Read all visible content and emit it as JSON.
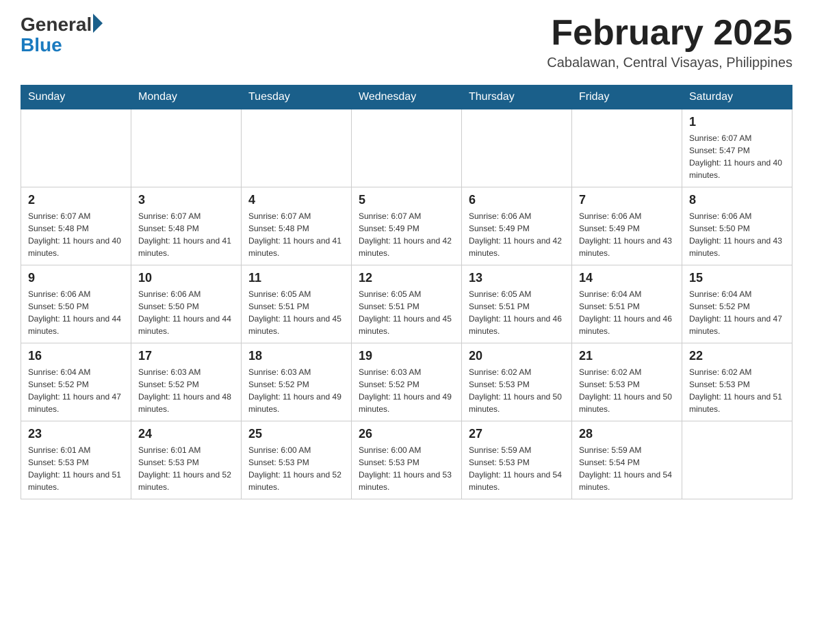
{
  "header": {
    "logo_general": "General",
    "logo_blue": "Blue",
    "month_title": "February 2025",
    "location": "Cabalawan, Central Visayas, Philippines"
  },
  "days_of_week": [
    "Sunday",
    "Monday",
    "Tuesday",
    "Wednesday",
    "Thursday",
    "Friday",
    "Saturday"
  ],
  "weeks": [
    [
      {
        "day": "",
        "sunrise": "",
        "sunset": "",
        "daylight": ""
      },
      {
        "day": "",
        "sunrise": "",
        "sunset": "",
        "daylight": ""
      },
      {
        "day": "",
        "sunrise": "",
        "sunset": "",
        "daylight": ""
      },
      {
        "day": "",
        "sunrise": "",
        "sunset": "",
        "daylight": ""
      },
      {
        "day": "",
        "sunrise": "",
        "sunset": "",
        "daylight": ""
      },
      {
        "day": "",
        "sunrise": "",
        "sunset": "",
        "daylight": ""
      },
      {
        "day": "1",
        "sunrise": "Sunrise: 6:07 AM",
        "sunset": "Sunset: 5:47 PM",
        "daylight": "Daylight: 11 hours and 40 minutes."
      }
    ],
    [
      {
        "day": "2",
        "sunrise": "Sunrise: 6:07 AM",
        "sunset": "Sunset: 5:48 PM",
        "daylight": "Daylight: 11 hours and 40 minutes."
      },
      {
        "day": "3",
        "sunrise": "Sunrise: 6:07 AM",
        "sunset": "Sunset: 5:48 PM",
        "daylight": "Daylight: 11 hours and 41 minutes."
      },
      {
        "day": "4",
        "sunrise": "Sunrise: 6:07 AM",
        "sunset": "Sunset: 5:48 PM",
        "daylight": "Daylight: 11 hours and 41 minutes."
      },
      {
        "day": "5",
        "sunrise": "Sunrise: 6:07 AM",
        "sunset": "Sunset: 5:49 PM",
        "daylight": "Daylight: 11 hours and 42 minutes."
      },
      {
        "day": "6",
        "sunrise": "Sunrise: 6:06 AM",
        "sunset": "Sunset: 5:49 PM",
        "daylight": "Daylight: 11 hours and 42 minutes."
      },
      {
        "day": "7",
        "sunrise": "Sunrise: 6:06 AM",
        "sunset": "Sunset: 5:49 PM",
        "daylight": "Daylight: 11 hours and 43 minutes."
      },
      {
        "day": "8",
        "sunrise": "Sunrise: 6:06 AM",
        "sunset": "Sunset: 5:50 PM",
        "daylight": "Daylight: 11 hours and 43 minutes."
      }
    ],
    [
      {
        "day": "9",
        "sunrise": "Sunrise: 6:06 AM",
        "sunset": "Sunset: 5:50 PM",
        "daylight": "Daylight: 11 hours and 44 minutes."
      },
      {
        "day": "10",
        "sunrise": "Sunrise: 6:06 AM",
        "sunset": "Sunset: 5:50 PM",
        "daylight": "Daylight: 11 hours and 44 minutes."
      },
      {
        "day": "11",
        "sunrise": "Sunrise: 6:05 AM",
        "sunset": "Sunset: 5:51 PM",
        "daylight": "Daylight: 11 hours and 45 minutes."
      },
      {
        "day": "12",
        "sunrise": "Sunrise: 6:05 AM",
        "sunset": "Sunset: 5:51 PM",
        "daylight": "Daylight: 11 hours and 45 minutes."
      },
      {
        "day": "13",
        "sunrise": "Sunrise: 6:05 AM",
        "sunset": "Sunset: 5:51 PM",
        "daylight": "Daylight: 11 hours and 46 minutes."
      },
      {
        "day": "14",
        "sunrise": "Sunrise: 6:04 AM",
        "sunset": "Sunset: 5:51 PM",
        "daylight": "Daylight: 11 hours and 46 minutes."
      },
      {
        "day": "15",
        "sunrise": "Sunrise: 6:04 AM",
        "sunset": "Sunset: 5:52 PM",
        "daylight": "Daylight: 11 hours and 47 minutes."
      }
    ],
    [
      {
        "day": "16",
        "sunrise": "Sunrise: 6:04 AM",
        "sunset": "Sunset: 5:52 PM",
        "daylight": "Daylight: 11 hours and 47 minutes."
      },
      {
        "day": "17",
        "sunrise": "Sunrise: 6:03 AM",
        "sunset": "Sunset: 5:52 PM",
        "daylight": "Daylight: 11 hours and 48 minutes."
      },
      {
        "day": "18",
        "sunrise": "Sunrise: 6:03 AM",
        "sunset": "Sunset: 5:52 PM",
        "daylight": "Daylight: 11 hours and 49 minutes."
      },
      {
        "day": "19",
        "sunrise": "Sunrise: 6:03 AM",
        "sunset": "Sunset: 5:52 PM",
        "daylight": "Daylight: 11 hours and 49 minutes."
      },
      {
        "day": "20",
        "sunrise": "Sunrise: 6:02 AM",
        "sunset": "Sunset: 5:53 PM",
        "daylight": "Daylight: 11 hours and 50 minutes."
      },
      {
        "day": "21",
        "sunrise": "Sunrise: 6:02 AM",
        "sunset": "Sunset: 5:53 PM",
        "daylight": "Daylight: 11 hours and 50 minutes."
      },
      {
        "day": "22",
        "sunrise": "Sunrise: 6:02 AM",
        "sunset": "Sunset: 5:53 PM",
        "daylight": "Daylight: 11 hours and 51 minutes."
      }
    ],
    [
      {
        "day": "23",
        "sunrise": "Sunrise: 6:01 AM",
        "sunset": "Sunset: 5:53 PM",
        "daylight": "Daylight: 11 hours and 51 minutes."
      },
      {
        "day": "24",
        "sunrise": "Sunrise: 6:01 AM",
        "sunset": "Sunset: 5:53 PM",
        "daylight": "Daylight: 11 hours and 52 minutes."
      },
      {
        "day": "25",
        "sunrise": "Sunrise: 6:00 AM",
        "sunset": "Sunset: 5:53 PM",
        "daylight": "Daylight: 11 hours and 52 minutes."
      },
      {
        "day": "26",
        "sunrise": "Sunrise: 6:00 AM",
        "sunset": "Sunset: 5:53 PM",
        "daylight": "Daylight: 11 hours and 53 minutes."
      },
      {
        "day": "27",
        "sunrise": "Sunrise: 5:59 AM",
        "sunset": "Sunset: 5:53 PM",
        "daylight": "Daylight: 11 hours and 54 minutes."
      },
      {
        "day": "28",
        "sunrise": "Sunrise: 5:59 AM",
        "sunset": "Sunset: 5:54 PM",
        "daylight": "Daylight: 11 hours and 54 minutes."
      },
      {
        "day": "",
        "sunrise": "",
        "sunset": "",
        "daylight": ""
      }
    ]
  ]
}
